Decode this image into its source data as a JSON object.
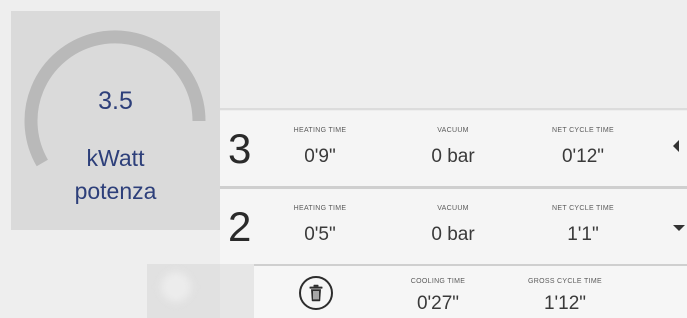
{
  "gauge": {
    "value": "3.5",
    "unit": "kWatt",
    "caption": "potenza",
    "fill_fraction": 0.36,
    "track_color": "#b9b9b9",
    "text_color": "#2d3f7a"
  },
  "rows": [
    {
      "number": "3",
      "heating_label": "HEATING TIME",
      "heating_value": "0'9\"",
      "vacuum_label": "VACUUM",
      "vacuum_value": "0 bar",
      "net_label": "NET CYCLE TIME",
      "net_value": "0'12\"",
      "control_icon": "triangle-left-icon"
    },
    {
      "number": "2",
      "heating_label": "HEATING TIME",
      "heating_value": "0'5\"",
      "vacuum_label": "VACUUM",
      "vacuum_value": "0 bar",
      "net_label": "NET CYCLE TIME",
      "net_value": "1'1\"",
      "control_icon": "triangle-down-icon"
    }
  ],
  "detail": {
    "delete_icon": "trash-icon",
    "cooling_label": "COOLING TIME",
    "cooling_value": "0'27\"",
    "gross_label": "GROSS CYCLE TIME",
    "gross_value": "1'12\""
  }
}
